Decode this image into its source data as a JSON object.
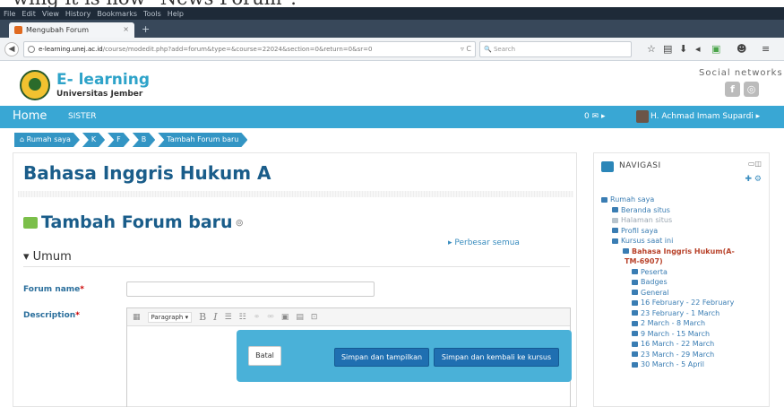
{
  "caption": {
    "text": "wing it is now \"News Forum\"."
  },
  "browser": {
    "menu": [
      "File",
      "Edit",
      "View",
      "History",
      "Bookmarks",
      "Tools",
      "Help"
    ],
    "tab_title": "Mengubah Forum",
    "tab_close": "×",
    "new_tab": "+",
    "url_host": "e-learning.unej.ac.id",
    "url_path": "/course/modedit.php?add=forum&type=&course=22024&section=0&return=0&sr=0",
    "reload": "▿ C",
    "search_placeholder": "Search"
  },
  "site": {
    "brand_title": "E- learning",
    "brand_subtitle": "Universitas Jember",
    "social_title": "Social networks"
  },
  "nav": {
    "home": "Home",
    "sister": "SISTER",
    "messages": "0 ✉ ▸",
    "user": "H. Achmad Imam Supardi ▸"
  },
  "breadcrumbs": [
    "Rumah saya",
    "K",
    "F",
    "B",
    "Tambah Forum baru"
  ],
  "main": {
    "course_title": "Bahasa Inggris Hukum A",
    "page_heading": "Tambah Forum baru",
    "expand_all": "▸ Perbesar semua",
    "section_umum": "▾ Umum",
    "forum_name_label": "Forum name",
    "description_label": "Description",
    "required_mark": "*",
    "editor_format": "Paragraph"
  },
  "dialog": {
    "cancel": "Batal",
    "save_display": "Simpan dan tampilkan",
    "save_return": "Simpan dan kembali ke kursus"
  },
  "sidebar": {
    "title": "NAVIGASI",
    "items": [
      {
        "label": "Rumah saya"
      },
      {
        "label": "Beranda situs"
      },
      {
        "label": "Halaman situs"
      },
      {
        "label": "Profil saya"
      },
      {
        "label": "Kursus saat ini"
      },
      {
        "label": "Bahasa Inggris Hukum(A-"
      },
      {
        "label": "TM-6907)"
      },
      {
        "label": "Peserta"
      },
      {
        "label": "Badges"
      },
      {
        "label": "General"
      },
      {
        "label": "16 February - 22 February"
      },
      {
        "label": "23 February - 1 March"
      },
      {
        "label": "2 March - 8 March"
      },
      {
        "label": "9 March - 15 March"
      },
      {
        "label": "16 March - 22 March"
      },
      {
        "label": "23 March - 29 March"
      },
      {
        "label": "30 March - 5 April"
      }
    ]
  }
}
